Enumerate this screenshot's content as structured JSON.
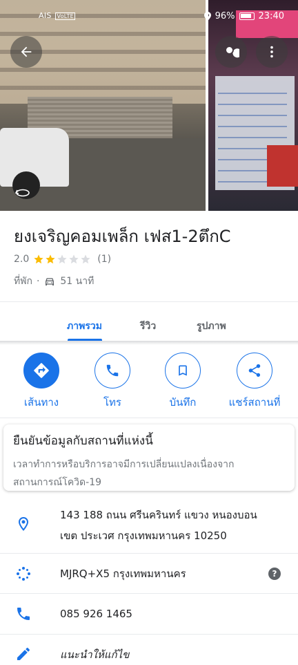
{
  "status_bar": {
    "carrier": "AIS",
    "network": "VoLTE",
    "battery": "96%",
    "time": "23:40"
  },
  "hero": {
    "back_icon": "arrow-back-icon",
    "search_icon": "search-icon",
    "more_icon": "more-vert-icon",
    "rotate_icon": "360-rotate-icon"
  },
  "place": {
    "title": "ยงเจริญคอมเพล็ก เฟส1-2ตึกC",
    "rating": "2.0",
    "rating_value": 2,
    "rating_max": 5,
    "reviews": "(1)",
    "category": "ที่พัก",
    "separator": "·",
    "travel_time": "51 นาที"
  },
  "tabs": [
    {
      "label": "ภาพรวม",
      "active": true
    },
    {
      "label": "รีวิว",
      "active": false
    },
    {
      "label": "รูปภาพ",
      "active": false
    }
  ],
  "actions": [
    {
      "label": "เส้นทาง",
      "icon": "directions-icon"
    },
    {
      "label": "โทร",
      "icon": "phone-icon"
    },
    {
      "label": "บันทึก",
      "icon": "bookmark-icon"
    },
    {
      "label": "แชร์สถานที่",
      "icon": "share-icon"
    }
  ],
  "covid_card": {
    "title": "ยืนยันข้อมูลกับสถานที่แห่งนี้",
    "body_line1": "เวลาทำการหรือบริการอาจมีการเปลี่ยนแปลงเนื่องจาก",
    "body_line2": "สถานการณ์โควิด-19"
  },
  "info": {
    "address_line1": "143 188 ถนน ศรีนครินทร์ แขวง หนองบอน",
    "address_line2": "เขต ประเวศ กรุงเทพมหานคร 10250",
    "plus_code": "MJRQ+X5 กรุงเทพมหานคร",
    "help": "?",
    "phone": "085 926 1465",
    "suggest_edit": "แนะนำให้แก้ไข"
  },
  "colors": {
    "accent": "#1a73e8",
    "star": "#fbbc04",
    "star_empty": "#dadce0",
    "secondary_text": "#70757a"
  }
}
